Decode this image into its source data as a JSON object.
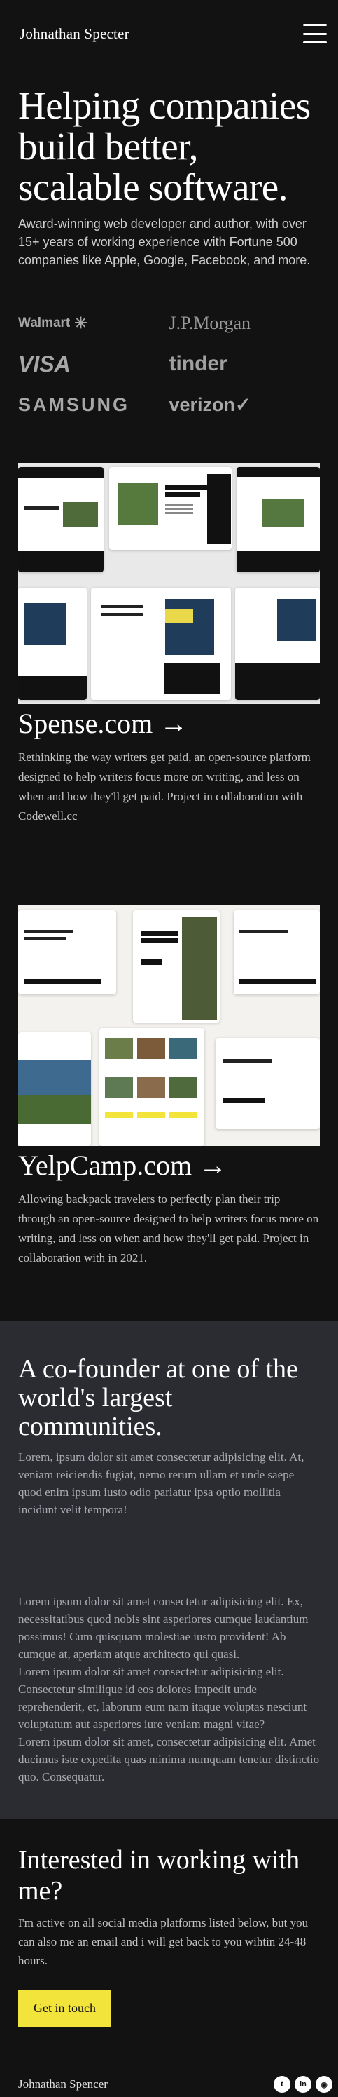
{
  "header": {
    "brand": "Johnathan Specter",
    "menu_icon": "hamburger-menu-icon"
  },
  "hero": {
    "title": "Helping companies build better, scalable software.",
    "subtitle": "Award-winning web developer and author, with over 15+ years of working experience with Fortune 500 companies like Apple, Google, Facebook, and more."
  },
  "logos": [
    "Walmart",
    "J.P.Morgan",
    "VISA",
    "tinder",
    "SAMSUNG",
    "verizon"
  ],
  "projects": [
    {
      "title": "Spense.com →",
      "description": "Rethinking the way writers get paid, an open-source platform designed to help writers focus more on writing, and less on when and how they'll get paid. Project in collaboration with Codewell.cc"
    },
    {
      "title": "YelpCamp.com →",
      "description": "Allowing backpack travelers to perfectly plan their trip through an open-source designed to help writers focus more on writing, and less on when and how they'll get paid. Project in collaboration with in 2021."
    }
  ],
  "community": {
    "title": "A co-founder at one of the world's largest communities.",
    "p1": "Lorem, ipsum dolor sit amet consectetur adipisicing elit. At, veniam reiciendis fugiat, nemo rerum ullam et unde saepe quod enim ipsum iusto odio pariatur ipsa optio mollitia incidunt velit tempora!",
    "p2": "Lorem ipsum dolor sit amet consectetur adipisicing elit. Ex, necessitatibus quod nobis sint asperiores cumque laudantium possimus! Cum quisquam molestiae iusto provident! Ab cumque at, aperiam atque architecto qui quasi.",
    "p3": "Lorem ipsum dolor sit amet consectetur adipisicing elit. Consectetur similique id eos dolores impedit unde reprehenderit, et, laborum eum nam itaque voluptas nesciunt voluptatum aut asperiores iure veniam magni vitae?",
    "p4": "Lorem ipsum dolor sit amet, consectetur adipisicing elit. Amet ducimus iste expedita quas minima numquam tenetur distinctio quo. Consequatur."
  },
  "contact": {
    "title": "Interested in working with me?",
    "text": "I'm active on all social media platforms listed below, but you can also me an email and i will get back to you wihtin 24-48 hours.",
    "cta": "Get in touch"
  },
  "footer": {
    "name": "Johnathan Spencer",
    "socials": [
      "twitter-icon",
      "linkedin-icon",
      "github-icon"
    ]
  },
  "colors": {
    "background": "#121212",
    "section": "#2b2c31",
    "accent": "#f3e43b"
  }
}
